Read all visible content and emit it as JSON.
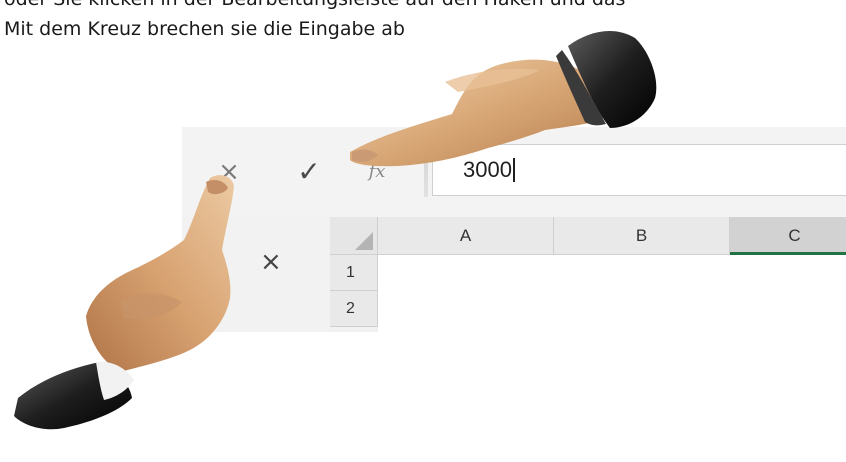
{
  "caption": {
    "line1": "oder  Sie klicken in der Bearbeitungsleiste auf den Haken und das",
    "line2": "Mit dem Kreuz brechen sie die Eingabe ab"
  },
  "formula_bar": {
    "cancel_icon": "×",
    "enter_icon": "✓",
    "fx_label": "fx",
    "input_value": "3000"
  },
  "grid": {
    "cancel_icon": "×",
    "columns": [
      "A",
      "B",
      "C"
    ],
    "rows": [
      "1",
      "2"
    ],
    "selected_column": "C",
    "accent_color": "#217346"
  },
  "icons": {
    "hand_upper": "pointing-hand-icon",
    "hand_lower": "pointing-hand-icon"
  }
}
